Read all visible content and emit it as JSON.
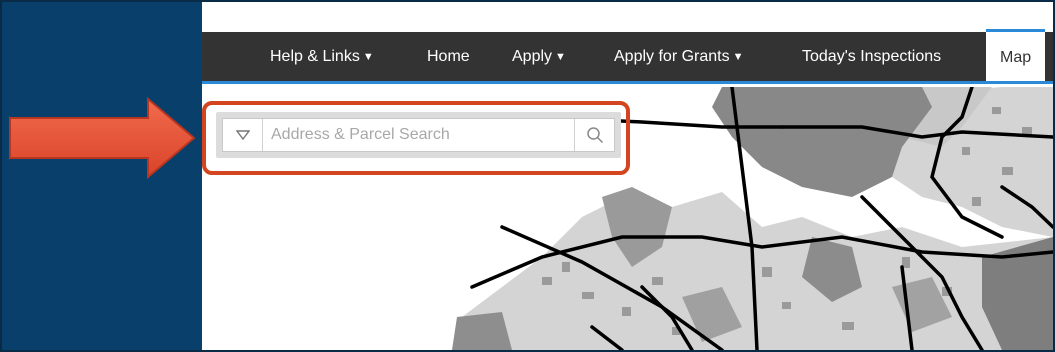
{
  "colors": {
    "background": "#083f6b",
    "navbar": "#333333",
    "nav_accent": "#2b8ad8",
    "arrow": "#e8553a",
    "highlight": "#d2451e",
    "map_dark": "#888888",
    "map_light": "#d4d4d4",
    "roads": "#000000"
  },
  "nav": {
    "items": [
      {
        "label": "Help & Links",
        "caret": "▼"
      },
      {
        "label": "Home"
      },
      {
        "label": "Apply",
        "caret": "▼"
      },
      {
        "label": "Apply for Grants",
        "caret": "▼"
      },
      {
        "label": "Today's Inspections"
      },
      {
        "label": "Map",
        "active": true
      }
    ]
  },
  "search": {
    "placeholder": "Address & Parcel Search",
    "value": "",
    "dropdown_icon": "triangle-down-icon",
    "button_icon": "search-icon"
  },
  "callout": {
    "arrow_icon": "arrow-right-icon"
  }
}
